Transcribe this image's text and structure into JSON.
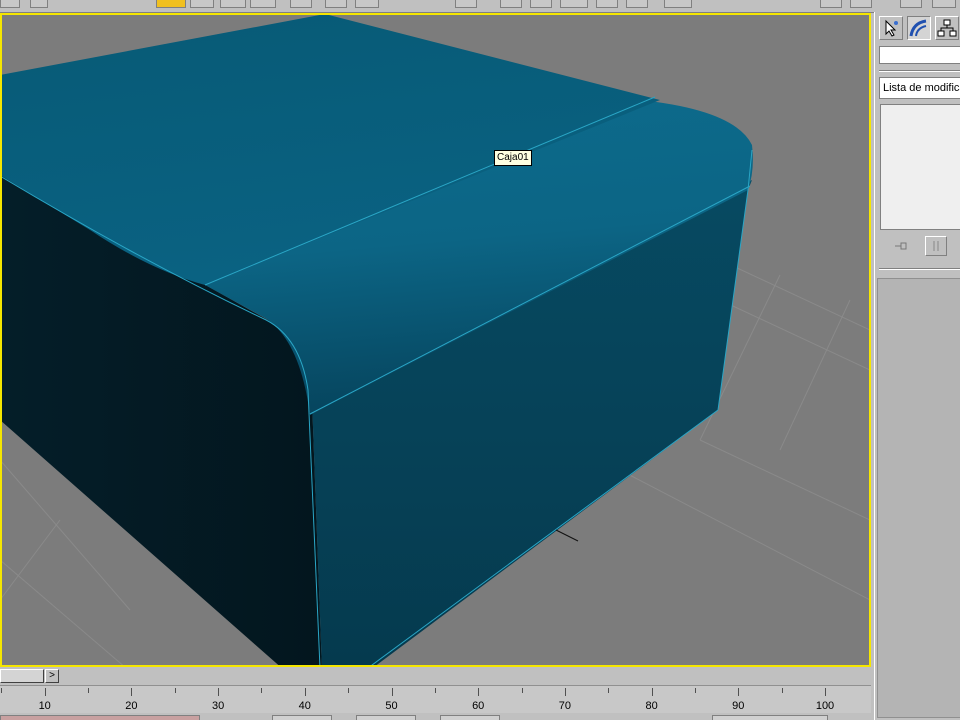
{
  "viewport": {
    "object_tooltip": "Caja01",
    "highlight_color": "#f5e600",
    "background_color": "#7c7c7c",
    "object_color": "#0a5d7a"
  },
  "command_panel": {
    "tabs": [
      {
        "icon": "create-cursor-icon",
        "selected": false
      },
      {
        "icon": "modify-curve-icon",
        "selected": true
      },
      {
        "icon": "hierarchy-icon",
        "selected": false
      }
    ],
    "object_name": "",
    "modifier_list_label": "Lista de modificadores",
    "stack_buttons": [
      {
        "icon": "pin-stack-icon"
      },
      {
        "icon": "show-end-result-icon"
      }
    ]
  },
  "time_slider": {
    "next_label": ">"
  },
  "trackbar": {
    "ticks": [
      "10",
      "20",
      "30",
      "40",
      "50",
      "60",
      "70",
      "80",
      "90",
      "100"
    ]
  }
}
